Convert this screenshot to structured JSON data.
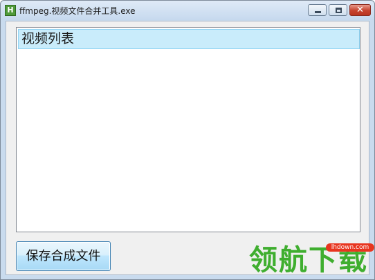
{
  "window": {
    "title": "ffmpeg.视频文件合并工具.exe",
    "icon_letter": "H",
    "controls": {
      "minimize_icon": "minimize-icon",
      "maximize_icon": "maximize-icon",
      "close_icon": "close-icon",
      "close_glyph": "✕"
    }
  },
  "list": {
    "header": "视频列表",
    "items": []
  },
  "buttons": {
    "save": "保存合成文件"
  },
  "watermark": {
    "text": "领航下载",
    "badge": "lhdown.com"
  },
  "colors": {
    "list_header_bg": "#c9ecfb",
    "button_bg": "#bee6fd",
    "watermark_green": "#3fae2f",
    "badge_red": "#e8351f"
  }
}
